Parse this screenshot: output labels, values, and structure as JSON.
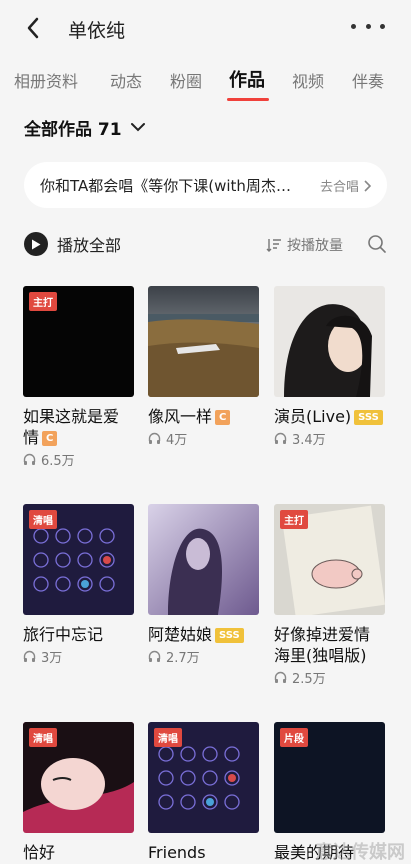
{
  "header": {
    "title": "单依纯"
  },
  "tabs": [
    {
      "label": "相册资料",
      "active": false
    },
    {
      "label": "动态",
      "active": false
    },
    {
      "label": "粉圈",
      "active": false
    },
    {
      "label": "作品",
      "active": true
    },
    {
      "label": "视频",
      "active": false
    },
    {
      "label": "伴奏",
      "active": false
    }
  ],
  "works": {
    "label": "全部作品 71"
  },
  "duet_pill": {
    "text": "你和TA都会唱《等你下课(with周杰伦)》",
    "action": "去合唱"
  },
  "toolbar": {
    "play_all": "播放全部",
    "sort": "按播放量"
  },
  "cards": [
    {
      "title": "如果这就是爱情",
      "tag": "C",
      "plays": "6.5万",
      "badge": "主打",
      "art": "black"
    },
    {
      "title": "像风一样",
      "tag": "C",
      "plays": "4万",
      "badge": "",
      "art": "field"
    },
    {
      "title": "演员(Live)",
      "tag": "SSS",
      "plays": "3.4万",
      "badge": "",
      "art": "portrait"
    },
    {
      "title": "旅行中忘记",
      "tag": "",
      "plays": "3万",
      "badge": "清唱",
      "art": "pads"
    },
    {
      "title": "阿楚姑娘",
      "tag": "SSS",
      "plays": "2.7万",
      "badge": "",
      "art": "purple"
    },
    {
      "title": "好像掉进爱情海里(独唱版)",
      "tag": "",
      "plays": "2.5万",
      "badge": "主打",
      "art": "pig"
    },
    {
      "title": "恰好",
      "tag": "",
      "plays": "",
      "badge": "清唱",
      "art": "face"
    },
    {
      "title": "Friends",
      "tag": "",
      "plays": "",
      "badge": "清唱",
      "art": "pads"
    },
    {
      "title": "最美的期待",
      "tag": "",
      "plays": "",
      "badge": "片段",
      "art": "navy"
    }
  ],
  "watermark": "意达传媒网",
  "colors": {
    "accent": "#f0413b",
    "tag_c": "#f2a25b",
    "tag_sss": "#f0c13a",
    "badge": "#e0493f"
  }
}
